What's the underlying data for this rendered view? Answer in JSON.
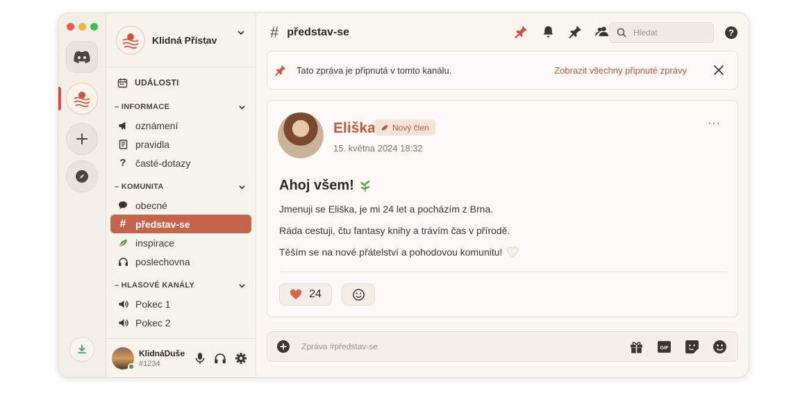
{
  "server": {
    "name": "Klidná Přístav"
  },
  "sidebar": {
    "events_label": "UDÁLOSTI",
    "categories": [
      {
        "label": "– INFORMACE",
        "channels": [
          {
            "name": "oznámení",
            "icon": "megaphone-icon"
          },
          {
            "name": "pravidla",
            "icon": "book-icon"
          },
          {
            "name": "časté-dotazy",
            "icon": "question-icon"
          }
        ]
      },
      {
        "label": "– KOMUNITA",
        "channels": [
          {
            "name": "obecné",
            "icon": "chat-bubble-icon"
          },
          {
            "name": "představ-se",
            "icon": "hash-icon",
            "active": true
          },
          {
            "name": "inspirace",
            "icon": "leaf-icon"
          },
          {
            "name": "poslechovna",
            "icon": "headphones-icon"
          }
        ]
      },
      {
        "label": "– HLASOVÉ KANÁLY",
        "channels": [
          {
            "name": "Pokec 1",
            "icon": "speaker-icon"
          },
          {
            "name": "Pokec 2",
            "icon": "speaker-icon"
          }
        ]
      }
    ]
  },
  "user": {
    "name": "KlidnáDuše",
    "tag": "#1234",
    "status_color": "#3fa25a"
  },
  "header": {
    "hash": "#",
    "channel_title": "představ-se",
    "search_placeholder": "Hledat"
  },
  "pinned_banner": {
    "text": "Tato zpráva je připnutá v tomto kanálu.",
    "link": "Zobrazit všechny připnuté zprávy"
  },
  "message": {
    "author": "Eliška",
    "badge": "Nový člen",
    "timestamp": "15. května 2024  18:32",
    "more": "···",
    "heading": "Ahoj všem!",
    "lines": [
      "Jmenuji se Eliška, je mi 24 let a pocházím z Brna.",
      "Ráda cestuji, čtu fantasy knihy a trávím čas v přírodě.",
      "Těším se na nové přátelství a pohodovou komunitu!"
    ],
    "reactions": [
      {
        "emoji": "heart-icon",
        "count": "24"
      }
    ]
  },
  "composer": {
    "placeholder": "Zpráva #představ-se"
  },
  "colors": {
    "accent": "#c0583c",
    "active_channel_bg": "#c2654b",
    "background": "#faf7f2"
  }
}
